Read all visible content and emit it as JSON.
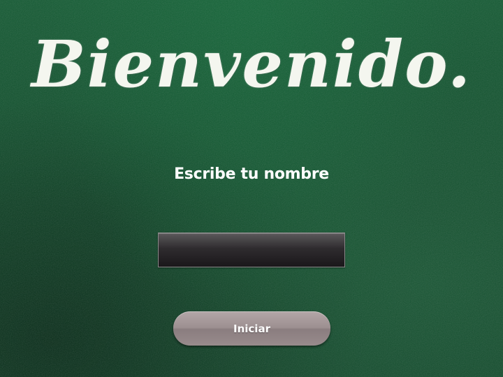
{
  "welcome": {
    "title": "Bienvenido."
  },
  "form": {
    "prompt": "Escribe tu nombre",
    "name_value": "",
    "name_placeholder": "",
    "start_label": "Iniciar"
  },
  "colors": {
    "background": "#125231",
    "text": "#ffffff",
    "input_fill": "#2a272a",
    "button_fill": "#9e9192"
  }
}
